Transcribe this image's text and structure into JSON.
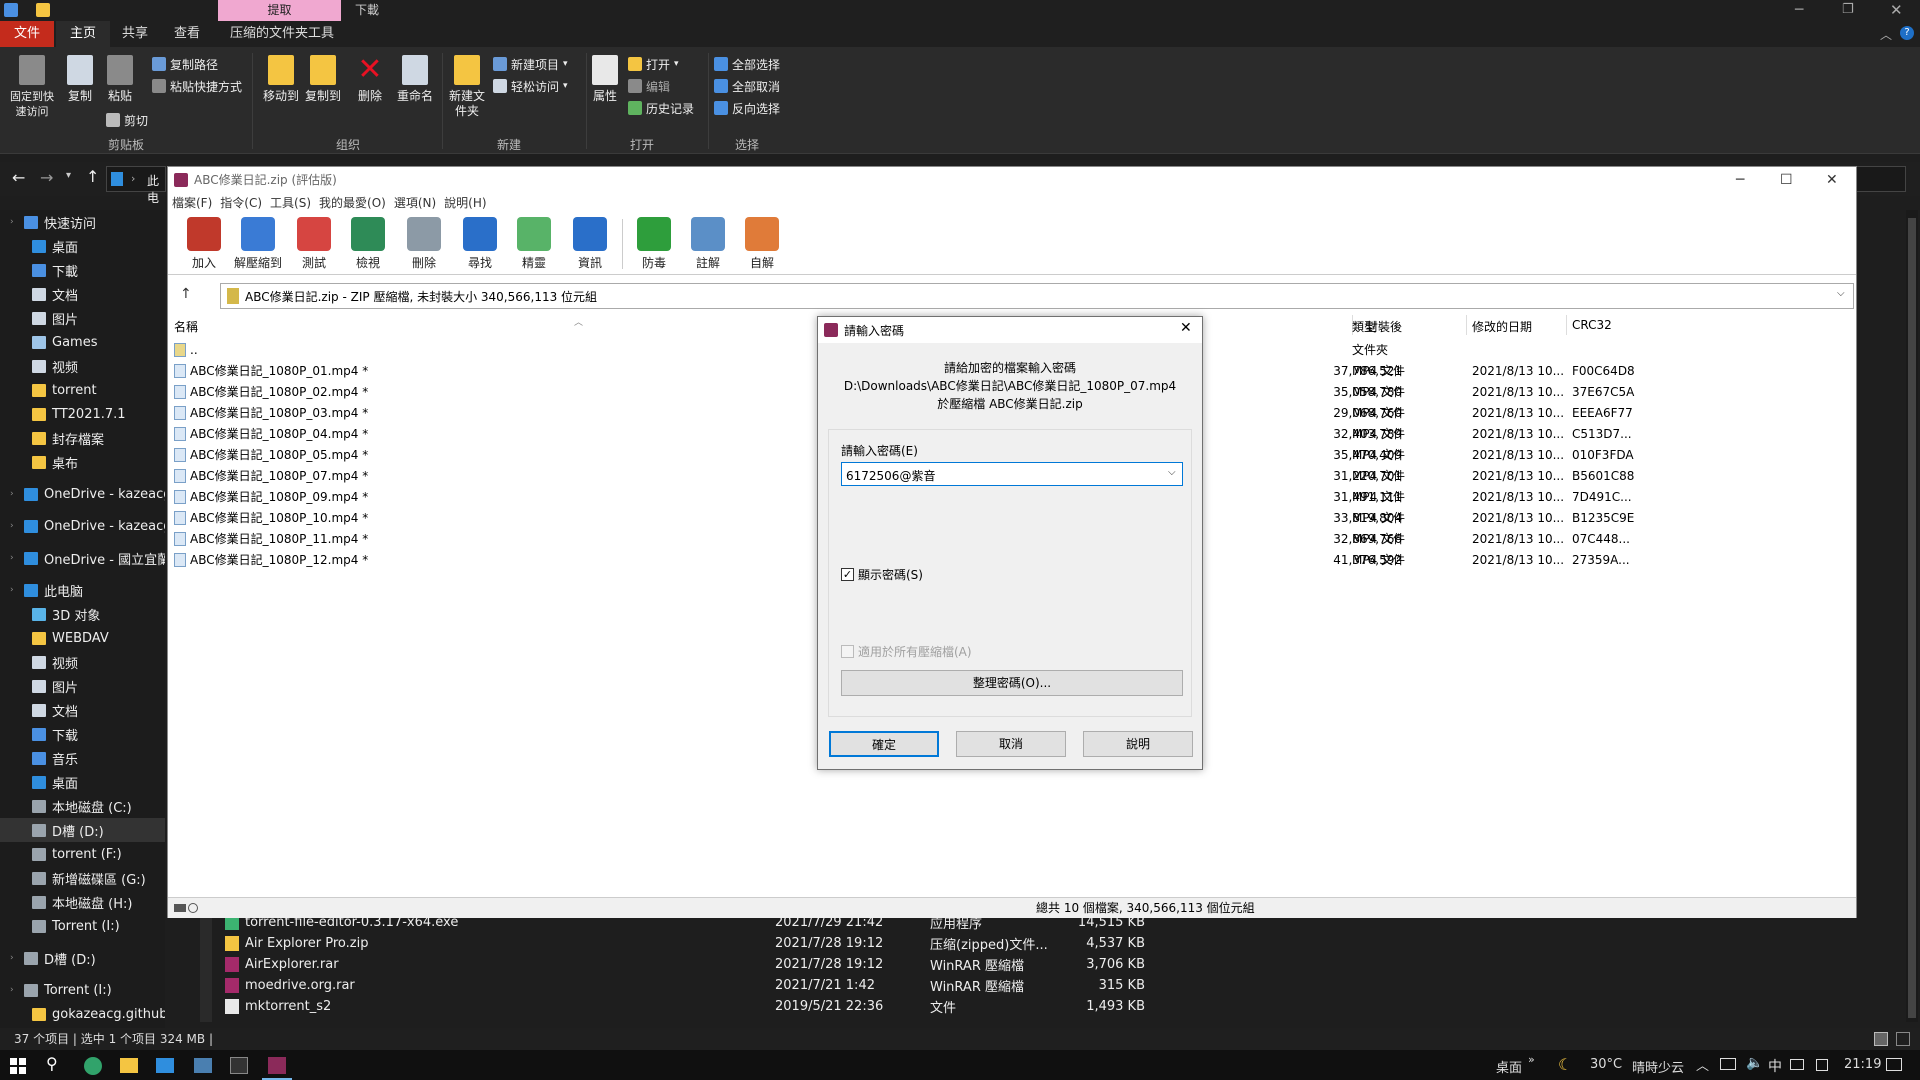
{
  "explorer": {
    "context_tabs": [
      "提取",
      "下載"
    ],
    "ribbon_tabs": [
      "文件",
      "主页",
      "共享",
      "查看",
      "压缩的文件夹工具"
    ],
    "ribbon": {
      "pin": "固定到快速访问",
      "copy": "复制",
      "paste": "粘贴",
      "copy_path": "复制路径",
      "paste_shortcut": "粘贴快捷方式",
      "cut": "剪切",
      "move_to": "移动到",
      "copy_to": "复制到",
      "delete": "删除",
      "rename": "重命名",
      "new_folder": "新建文件夹",
      "new_item": "新建项目",
      "easy_access": "轻松访问",
      "properties": "属性",
      "open": "打开",
      "edit": "编辑",
      "history": "历史记录",
      "select_all": "全部选择",
      "select_none": "全部取消",
      "invert": "反向选择",
      "groups": [
        "剪贴板",
        "组织",
        "新建",
        "打开",
        "选择"
      ]
    },
    "nav_path": "此电",
    "sidebar": [
      {
        "label": "快速访问",
        "icon": "star-icon",
        "color": "#4a90e2",
        "indent": 0
      },
      {
        "label": "桌面",
        "icon": "desktop-icon",
        "color": "#2f8ede",
        "indent": 1
      },
      {
        "label": "下載",
        "icon": "download-icon",
        "color": "#4a90e2",
        "indent": 1
      },
      {
        "label": "文档",
        "icon": "document-icon",
        "color": "#cfd8e3",
        "indent": 1
      },
      {
        "label": "图片",
        "icon": "picture-icon",
        "color": "#cfd8e3",
        "indent": 1
      },
      {
        "label": "Games",
        "icon": "games-icon",
        "color": "#9ec5e8",
        "indent": 1
      },
      {
        "label": "视频",
        "icon": "video-icon",
        "color": "#cfd8e3",
        "indent": 1
      },
      {
        "label": "torrent",
        "icon": "folder-icon",
        "color": "#f4c542",
        "indent": 1
      },
      {
        "label": "TT2021.7.1",
        "icon": "folder-icon",
        "color": "#f4c542",
        "indent": 1
      },
      {
        "label": "封存檔案",
        "icon": "folder-icon",
        "color": "#f4c542",
        "indent": 1
      },
      {
        "label": "桌布",
        "icon": "folder-icon",
        "color": "#f4c542",
        "indent": 1
      },
      {
        "label": "",
        "icon": "",
        "color": "",
        "indent": 0
      },
      {
        "label": "OneDrive - kazeacg",
        "icon": "cloud-icon",
        "color": "#2f8ede",
        "indent": 0
      },
      {
        "label": "",
        "icon": "",
        "color": "",
        "indent": 0
      },
      {
        "label": "OneDrive - kazeacg",
        "icon": "cloud-icon",
        "color": "#2f8ede",
        "indent": 0
      },
      {
        "label": "",
        "icon": "",
        "color": "",
        "indent": 0
      },
      {
        "label": "OneDrive - 國立宜蘭大",
        "icon": "cloud-icon",
        "color": "#2f8ede",
        "indent": 0
      },
      {
        "label": "",
        "icon": "",
        "color": "",
        "indent": 0
      },
      {
        "label": "此电脑",
        "icon": "computer-icon",
        "color": "#2f8ede",
        "indent": 0
      },
      {
        "label": "3D 对象",
        "icon": "cube-icon",
        "color": "#59b4e8",
        "indent": 1
      },
      {
        "label": "WEBDAV",
        "icon": "folder-icon",
        "color": "#f4c542",
        "indent": 1
      },
      {
        "label": "视频",
        "icon": "video-icon",
        "color": "#cfd8e3",
        "indent": 1
      },
      {
        "label": "图片",
        "icon": "picture-icon",
        "color": "#cfd8e3",
        "indent": 1
      },
      {
        "label": "文档",
        "icon": "document-icon",
        "color": "#cfd8e3",
        "indent": 1
      },
      {
        "label": "下载",
        "icon": "download-icon",
        "color": "#4a90e2",
        "indent": 1
      },
      {
        "label": "音乐",
        "icon": "music-icon",
        "color": "#4a90e2",
        "indent": 1
      },
      {
        "label": "桌面",
        "icon": "desktop-icon",
        "color": "#2f8ede",
        "indent": 1
      },
      {
        "label": "本地磁盘 (C:)",
        "icon": "drive-icon",
        "color": "#9aa4ad",
        "indent": 1
      },
      {
        "label": "D槽 (D:)",
        "icon": "drive-icon",
        "color": "#9aa4ad",
        "indent": 1
      },
      {
        "label": "torrent (F:)",
        "icon": "drive-icon",
        "color": "#9aa4ad",
        "indent": 1
      },
      {
        "label": "新增磁碟區 (G:)",
        "icon": "drive-icon",
        "color": "#9aa4ad",
        "indent": 1
      },
      {
        "label": "本地磁盘 (H:)",
        "icon": "drive-icon",
        "color": "#9aa4ad",
        "indent": 1
      },
      {
        "label": "Torrent (I:)",
        "icon": "drive-icon",
        "color": "#9aa4ad",
        "indent": 1
      },
      {
        "label": "",
        "icon": "",
        "color": "",
        "indent": 0
      },
      {
        "label": "D槽 (D:)",
        "icon": "drive-icon",
        "color": "#9aa4ad",
        "indent": 0
      },
      {
        "label": "",
        "icon": "",
        "color": "",
        "indent": 0
      },
      {
        "label": "Torrent (I:)",
        "icon": "drive-icon",
        "color": "#9aa4ad",
        "indent": 0
      },
      {
        "label": "gokazeacg.github.io",
        "icon": "folder-icon",
        "color": "#f4c542",
        "indent": 1
      }
    ],
    "files": [
      {
        "name": "torrent-file-editor-0.3.17-x64.exe",
        "date": "2021/7/29 21:42",
        "type": "应用程序",
        "size": "14,515 KB",
        "color": "#3cb371"
      },
      {
        "name": "Air Explorer Pro.zip",
        "date": "2021/7/28 19:12",
        "type": "压缩(zipped)文件...",
        "size": "4,537 KB",
        "color": "#f4c542"
      },
      {
        "name": "AirExplorer.rar",
        "date": "2021/7/28 19:12",
        "type": "WinRAR 壓縮檔",
        "size": "3,706 KB",
        "color": "#a52a6a"
      },
      {
        "name": "moedrive.org.rar",
        "date": "2021/7/21 1:42",
        "type": "WinRAR 壓縮檔",
        "size": "315 KB",
        "color": "#a52a6a"
      },
      {
        "name": "mktorrent_s2",
        "date": "2019/5/21 22:36",
        "type": "文件",
        "size": "1,493 KB",
        "color": "#e8e8e8"
      }
    ],
    "status": "37 个项目  |  选中 1 个项目  324 MB  |"
  },
  "winrar": {
    "title": "ABC修業日記.zip (評估版)",
    "menu": [
      "檔案(F)",
      "指令(C)",
      "工具(S)",
      "我的最愛(O)",
      "選項(N)",
      "說明(H)"
    ],
    "tools": [
      {
        "label": "加入",
        "icon": "add-archive-icon",
        "color": "#c0392b"
      },
      {
        "label": "解壓縮到",
        "icon": "extract-to-icon",
        "color": "#3a7bd5"
      },
      {
        "label": "測試",
        "icon": "test-icon",
        "color": "#d64541"
      },
      {
        "label": "檢視",
        "icon": "view-icon",
        "color": "#2e8b57"
      },
      {
        "label": "刪除",
        "icon": "delete-icon",
        "color": "#8c9aa6"
      },
      {
        "label": "尋找",
        "icon": "find-icon",
        "color": "#2a6fc9"
      },
      {
        "label": "精靈",
        "icon": "wizard-icon",
        "color": "#58b368"
      },
      {
        "label": "資訊",
        "icon": "info-icon",
        "color": "#2a6fc9"
      },
      {
        "label": "防毒",
        "icon": "virus-scan-icon",
        "color": "#2e9e3c"
      },
      {
        "label": "註解",
        "icon": "comment-icon",
        "color": "#5b8fc7"
      },
      {
        "label": "自解",
        "icon": "sfx-icon",
        "color": "#e07b39"
      }
    ],
    "path": "ABC修業日記.zip - ZIP 壓縮檔, 未封裝大小 340,566,113 位元組",
    "columns": [
      "名稱",
      "封裝後",
      "類型",
      "修改的日期",
      "CRC32"
    ],
    "parent_row": {
      "name": "..",
      "type": "文件夾"
    },
    "files": [
      {
        "name": "ABC修業日記_1080P_01.mp4 *",
        "packed": "37,786,521",
        "type": "MP4 文件",
        "date": "2021/8/13 10...",
        "crc": "F00C64D8"
      },
      {
        "name": "ABC修業日記_1080P_02.mp4 *",
        "packed": "35,058,780",
        "type": "MP4 文件",
        "date": "2021/8/13 10...",
        "crc": "37E67C5A"
      },
      {
        "name": "ABC修業日記_1080P_03.mp4 *",
        "packed": "29,068,760",
        "type": "MP4 文件",
        "date": "2021/8/13 10...",
        "crc": "EEEA6F77"
      },
      {
        "name": "ABC修業日記_1080P_04.mp4 *",
        "packed": "32,403,789",
        "type": "MP4 文件",
        "date": "2021/8/13 10...",
        "crc": "C513D7..."
      },
      {
        "name": "ABC修業日記_1080P_05.mp4 *",
        "packed": "35,470,409",
        "type": "MP4 文件",
        "date": "2021/8/13 10...",
        "crc": "010F3FDA"
      },
      {
        "name": "ABC修業日記_1080P_07.mp4 *",
        "packed": "31,220,701",
        "type": "MP4 文件",
        "date": "2021/8/13 10...",
        "crc": "B5601C88"
      },
      {
        "name": "ABC修業日記_1080P_09.mp4 *",
        "packed": "31,491,111",
        "type": "MP4 文件",
        "date": "2021/8/13 10...",
        "crc": "7D491C..."
      },
      {
        "name": "ABC修業日記_1080P_10.mp4 *",
        "packed": "33,819,804",
        "type": "MP4 文件",
        "date": "2021/8/13 10...",
        "crc": "B1235C9E"
      },
      {
        "name": "ABC修業日記_1080P_11.mp4 *",
        "packed": "32,869,766",
        "type": "MP4 文件",
        "date": "2021/8/13 10...",
        "crc": "07C448..."
      },
      {
        "name": "ABC修業日記_1080P_12.mp4 *",
        "packed": "41,376,592",
        "type": "MP4 文件",
        "date": "2021/8/13 10...",
        "crc": "27359A..."
      }
    ],
    "status": "總共 10 個檔案, 340,566,113 個位元組"
  },
  "dialog": {
    "title": "請輸入密碼",
    "message_line1": "請給加密的檔案輸入密碼",
    "message_line2": "D:\\Downloads\\ABC修業日記\\ABC修業日記_1080P_07.mp4",
    "message_line3": "於壓縮檔 ABC修業日記.zip",
    "password_label": "請輸入密碼(E)",
    "password_value": "6172506@紫音",
    "show_password": "顯示密碼(S)",
    "apply_all": "適用於所有壓縮檔(A)",
    "organize": "整理密碼(O)...",
    "ok": "確定",
    "cancel": "取消",
    "help": "說明"
  },
  "taskbar": {
    "desktop": "桌面",
    "weather_temp": "30°C",
    "weather_desc": "晴時少云",
    "ime": "中",
    "time": "21:19"
  },
  "colors": {
    "accent": "#0078d7",
    "file_tab": "#c42b1c",
    "context_tab": "#f0a8d0"
  }
}
